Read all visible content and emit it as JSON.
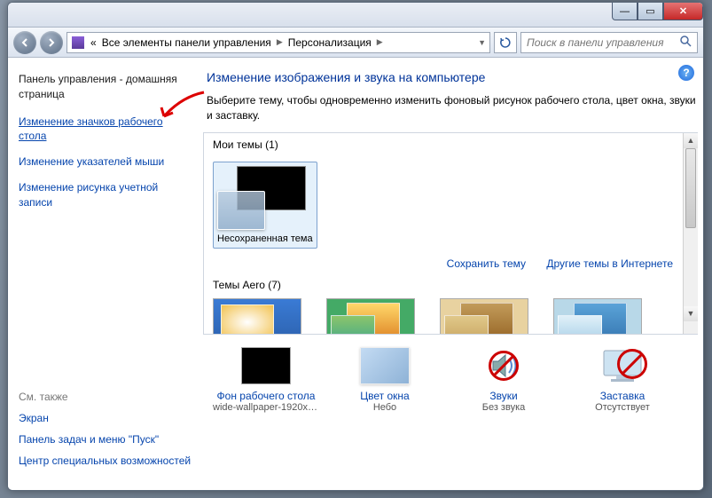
{
  "titlebar": {
    "min": "—",
    "max": "▭",
    "close": "✕"
  },
  "navbar": {
    "breadcrumb_prefix": "«",
    "breadcrumb_1": "Все элементы панели управления",
    "breadcrumb_2": "Персонализация",
    "search_placeholder": "Поиск в панели управления"
  },
  "sidebar": {
    "home": "Панель управления - домашняя страница",
    "links": [
      "Изменение значков рабочего стола",
      "Изменение указателей мыши",
      "Изменение рисунка учетной записи"
    ],
    "see_also": "См. также",
    "footer": [
      "Экран",
      "Панель задач и меню \"Пуск\"",
      "Центр специальных возможностей"
    ]
  },
  "main": {
    "heading": "Изменение изображения и звука на компьютере",
    "description": "Выберите тему, чтобы одновременно изменить фоновый рисунок рабочего стола, цвет окна, звуки и заставку.",
    "my_themes": "Мои темы (1)",
    "unsaved_theme": "Несохраненная тема",
    "save_theme": "Сохранить тему",
    "online_themes": "Другие темы в Интернете",
    "aero_themes": "Темы Aero (7)"
  },
  "bottom": {
    "bg": {
      "label": "Фон рабочего стола",
      "value": "wide-wallpaper-1920x10..."
    },
    "color": {
      "label": "Цвет окна",
      "value": "Небо"
    },
    "sounds": {
      "label": "Звуки",
      "value": "Без звука"
    },
    "screensaver": {
      "label": "Заставка",
      "value": "Отсутствует"
    }
  }
}
